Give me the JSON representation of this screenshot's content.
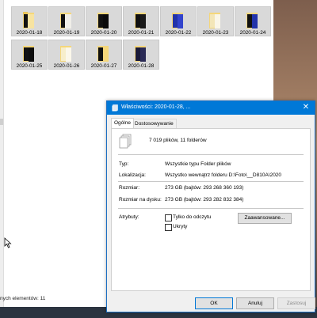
{
  "explorer": {
    "folders_row1": [
      "2020-01-18",
      "2020-01-19",
      "2020-01-20",
      "2020-01-21",
      "2020-01-22",
      "2020-01-23",
      "2020-01-24"
    ],
    "folders_row2": [
      "2020-01-25",
      "2020-01-26",
      "2020-01-27",
      "2020-01-28"
    ],
    "status_text": "nych elementów: 11"
  },
  "dialog": {
    "title": "Właściwości: 2020-01-28, ...",
    "close_glyph": "✕",
    "tabs": [
      "Ogólne",
      "Dostosowywanie"
    ],
    "summary": "7 019 plików, 11 folderów",
    "rows": [
      {
        "label": "Typ:",
        "value": "Wszystkie typu Folder plików"
      },
      {
        "label": "Lokalizacja:",
        "value": "Wszystko wewnątrz folderu D:\\Foto\\__D810A\\2020"
      },
      {
        "label": "Rozmiar:",
        "value": "273 GB (bajtów: 293 268 360 193)"
      },
      {
        "label": "Rozmiar na dysku:",
        "value": "273 GB (bajtów: 293 282 832 384)"
      }
    ],
    "attributes_label": "Atrybuty:",
    "readonly_label": "Tylko do odczytu",
    "hidden_label": "Ukryty",
    "advanced_button": "Zaawansowane...",
    "ok_button": "OK",
    "cancel_button": "Anuluj",
    "apply_button": "Zastosuj"
  },
  "colors": {
    "title_bar": "#0078d7",
    "folder_yellow": "#f5d77a",
    "folder_black": "#111111",
    "folder_blue": "#2233aa"
  }
}
